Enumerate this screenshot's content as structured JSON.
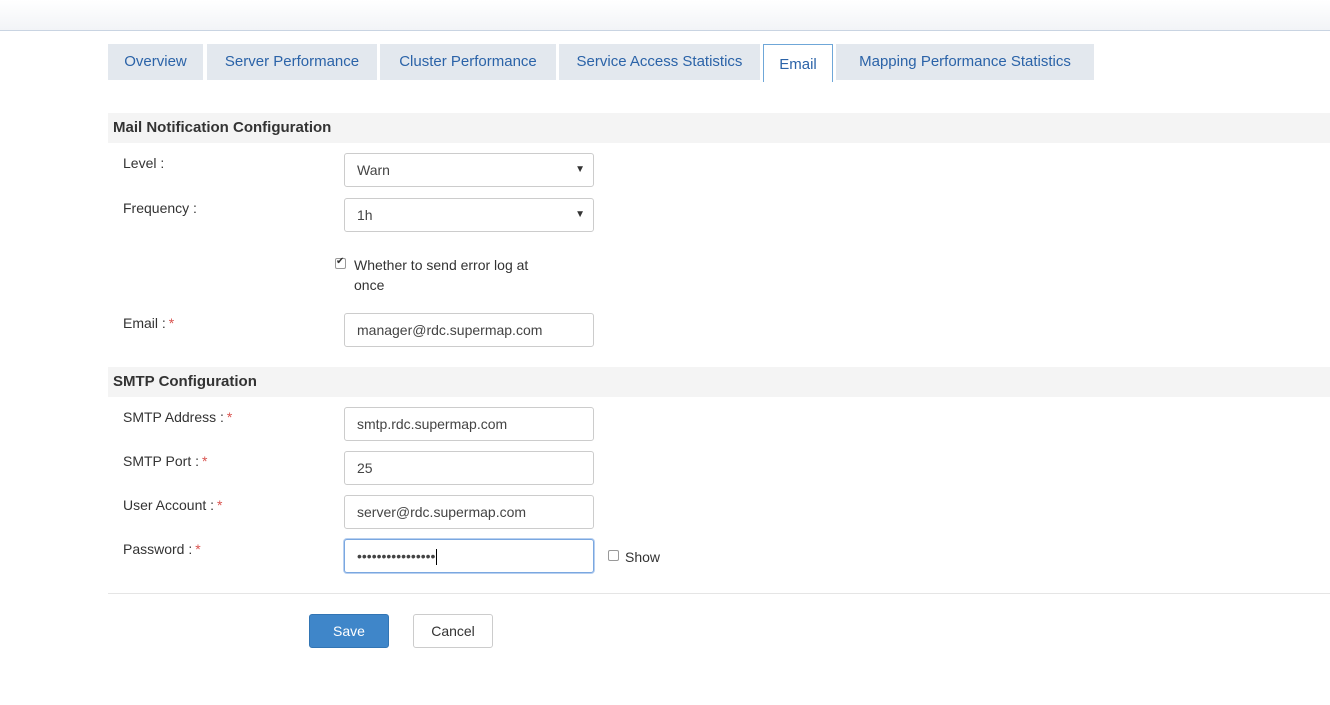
{
  "tabs": [
    {
      "label": "Overview"
    },
    {
      "label": "Server Performance"
    },
    {
      "label": "Cluster Performance"
    },
    {
      "label": "Service Access Statistics"
    },
    {
      "label": "Email"
    },
    {
      "label": "Mapping Performance Statistics"
    }
  ],
  "active_tab": "Email",
  "mail": {
    "heading": "Mail Notification Configuration",
    "level_label": "Level :",
    "level_value": "Warn",
    "frequency_label": "Frequency :",
    "frequency_value": "1h",
    "send_error_log_checked": true,
    "send_error_log_line1": "Whether to send error log at",
    "send_error_log_line2": "once",
    "email_label": "Email :",
    "email_value": "manager@rdc.supermap.com"
  },
  "smtp": {
    "heading": "SMTP Configuration",
    "address_label": "SMTP Address :",
    "address_value": "smtp.rdc.supermap.com",
    "port_label": "SMTP Port :",
    "port_value": "25",
    "account_label": "User Account :",
    "account_value": "server@rdc.supermap.com",
    "password_label": "Password :",
    "password_value": "••••••••••••••••",
    "show_label": "Show",
    "show_checked": false
  },
  "required_mark": "*",
  "actions": {
    "save_label": "Save",
    "cancel_label": "Cancel"
  }
}
